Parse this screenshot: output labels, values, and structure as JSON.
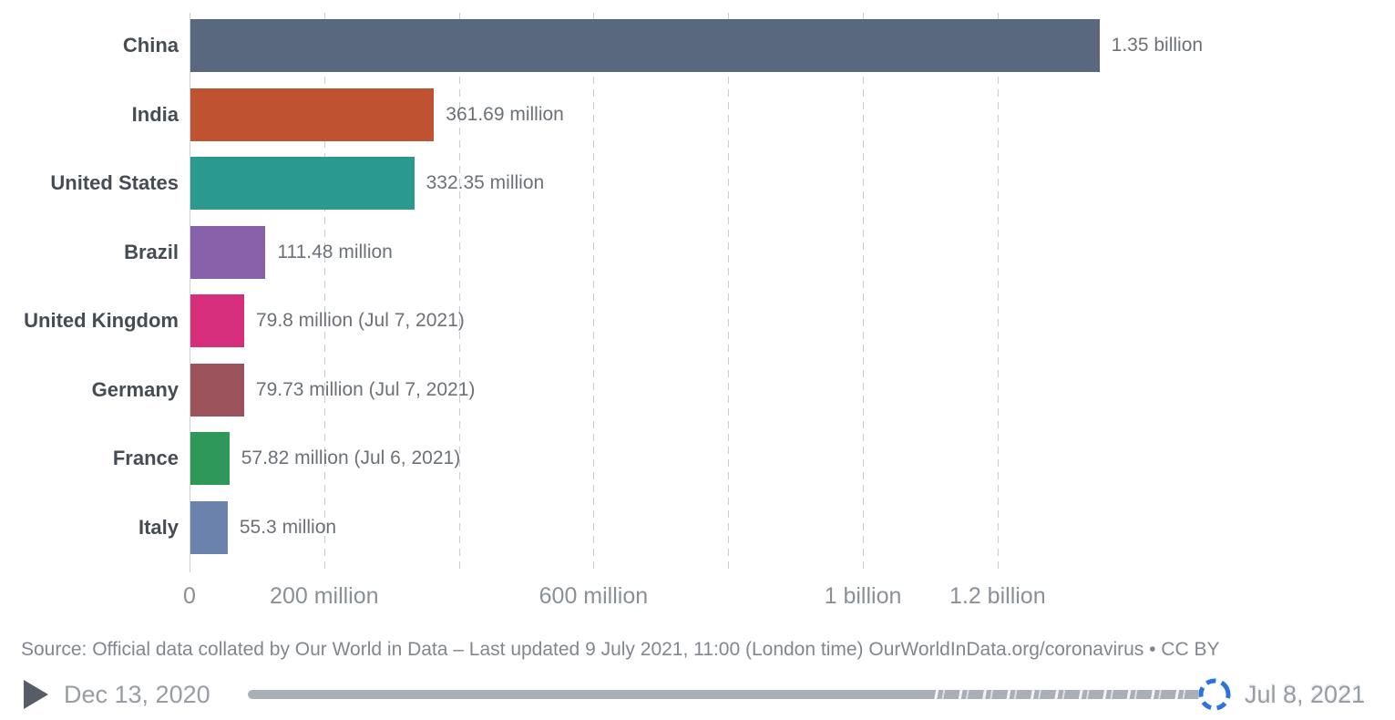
{
  "chart_data": {
    "type": "bar",
    "orientation": "horizontal",
    "categories": [
      "China",
      "India",
      "United States",
      "Brazil",
      "United Kingdom",
      "Germany",
      "France",
      "Italy"
    ],
    "values_millions": [
      1350,
      361.69,
      332.35,
      111.48,
      79.8,
      79.73,
      57.82,
      55.3
    ],
    "value_labels": [
      "1.35 billion",
      "361.69 million",
      "332.35 million",
      "111.48 million",
      "79.8 million (Jul 7, 2021)",
      "79.73 million (Jul 7, 2021)",
      "57.82 million (Jul 6, 2021)",
      "55.3 million"
    ],
    "bar_colors": [
      "#59687f",
      "#be5231",
      "#2a9a8e",
      "#8762aa",
      "#d62d7d",
      "#9b525a",
      "#2e9858",
      "#6b82ad"
    ],
    "x_ticks": [
      {
        "value_millions": 0,
        "label": "0"
      },
      {
        "value_millions": 200,
        "label": "200 million"
      },
      {
        "value_millions": 400,
        "label": ""
      },
      {
        "value_millions": 600,
        "label": "600 million"
      },
      {
        "value_millions": 800,
        "label": ""
      },
      {
        "value_millions": 1000,
        "label": "1 billion"
      },
      {
        "value_millions": 1200,
        "label": "1.2 billion"
      }
    ],
    "xlim_millions": [
      0,
      1400
    ],
    "grid": "dashed-vertical",
    "title": "",
    "xlabel": "",
    "ylabel": ""
  },
  "source_line": "Source: Official data collated by Our World in Data – Last updated 9 July 2021, 11:00 (London time) OurWorldInData.org/coronavirus • CC BY",
  "timeline": {
    "start_label": "Dec 13, 2020",
    "end_label": "Jul 8, 2021",
    "spinner_color": "#2b74d9"
  }
}
